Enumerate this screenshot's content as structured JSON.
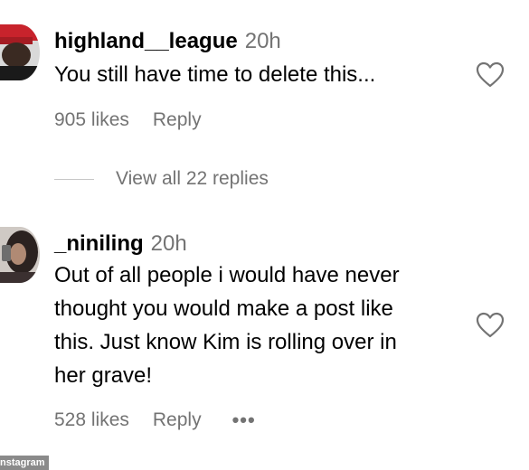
{
  "comments": [
    {
      "username": "highland__league",
      "time": "20h",
      "text": "You still have time to delete this...",
      "likes": "905 likes",
      "reply": "Reply"
    },
    {
      "username": "_niniling",
      "time": "20h",
      "text_lines": [
        "Out of all people i would have never",
        "thought you would make a post like",
        "this. Just know Kim is rolling over in",
        "her grave!"
      ],
      "likes": "528 likes",
      "reply": "Reply",
      "more": "•••"
    }
  ],
  "view_replies": "View all 22 replies",
  "watermark": "nstagram",
  "icons": {
    "like": "heart-outline-icon",
    "more": "more-options-icon"
  },
  "colors": {
    "secondary_text": "#737373"
  }
}
